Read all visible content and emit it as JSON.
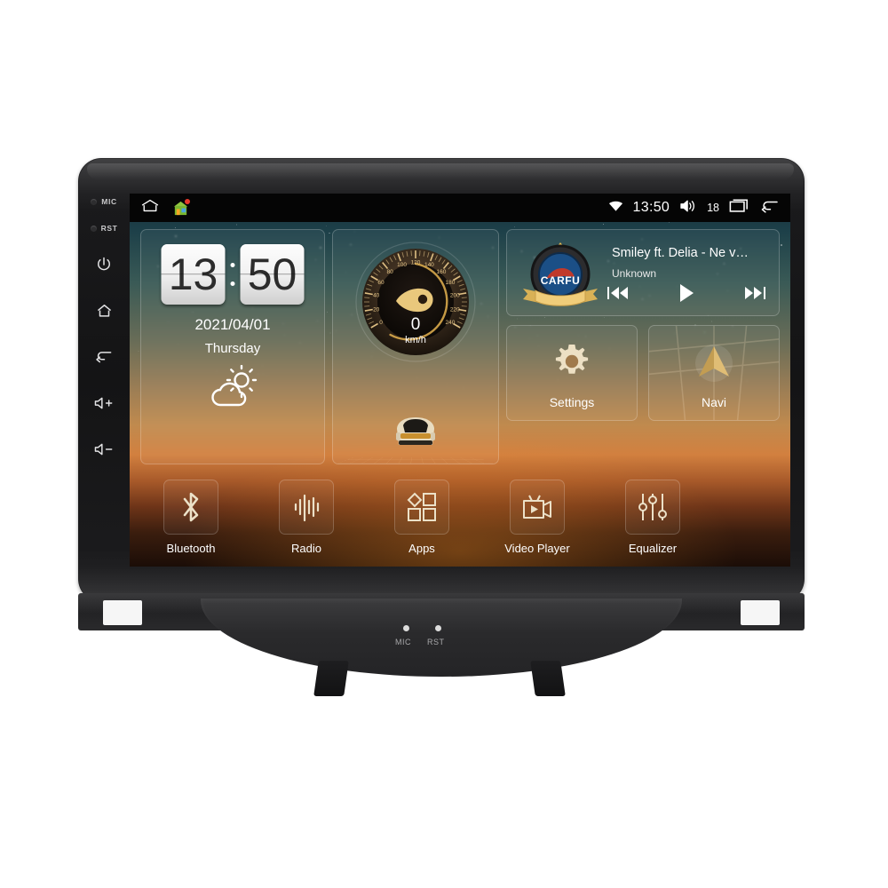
{
  "device": {
    "name": "car-stereo-head-unit",
    "side_buttons": [
      {
        "name": "mic-hole",
        "label": "MIC"
      },
      {
        "name": "reset-hole",
        "label": "RST"
      },
      {
        "name": "power-button",
        "label": ""
      },
      {
        "name": "home-button",
        "label": ""
      },
      {
        "name": "back-button",
        "label": ""
      },
      {
        "name": "volume-up-button",
        "label": ""
      },
      {
        "name": "volume-down-button",
        "label": ""
      }
    ],
    "bottom_panel": {
      "mic_label": "MIC",
      "reset_label": "RST"
    }
  },
  "statusbar": {
    "home_icon": "home-outline-icon",
    "app_icon": "house-app-icon",
    "wifi_icon": "wifi-icon",
    "time": "13:50",
    "volume_icon": "volume-icon",
    "volume_level": "18",
    "recents_icon": "recents-icon",
    "back_icon": "back-arrow-icon"
  },
  "clock_widget": {
    "hours": "13",
    "minutes": "50",
    "date": "2021/04/01",
    "weekday": "Thursday",
    "weather_icon": "partly-cloudy-icon"
  },
  "speedometer_widget": {
    "value": "0",
    "unit": "km/h",
    "ticks": [
      "0",
      "20",
      "40",
      "60",
      "80",
      "100",
      "120",
      "140",
      "160",
      "180",
      "200",
      "220",
      "240"
    ],
    "min": 0,
    "max": 240
  },
  "music_widget": {
    "logo_text": "CARFU",
    "title": "Smiley ft. Delia - Ne v…",
    "artist": "Unknown",
    "prev_icon": "previous-track-icon",
    "play_icon": "play-icon",
    "next_icon": "next-track-icon"
  },
  "tiles": [
    {
      "name": "settings",
      "label": "Settings",
      "icon": "gear-icon"
    },
    {
      "name": "navi",
      "label": "Navi",
      "icon": "navigation-arrow-icon"
    }
  ],
  "dock": [
    {
      "name": "bluetooth",
      "label": "Bluetooth",
      "icon": "bluetooth-icon"
    },
    {
      "name": "radio",
      "label": "Radio",
      "icon": "radio-waveform-icon"
    },
    {
      "name": "apps",
      "label": "Apps",
      "icon": "apps-grid-icon"
    },
    {
      "name": "video-player",
      "label": "Video Player",
      "icon": "video-camera-icon"
    },
    {
      "name": "equalizer",
      "label": "Equalizer",
      "icon": "equalizer-sliders-icon"
    }
  ],
  "colors": {
    "accent_gold": "#d8b46a",
    "bezel": "#141415",
    "statusbar": "#050505",
    "text": "#ffffff",
    "notification": "#e8392b",
    "logo_blue": "#1b4f86",
    "logo_red": "#c0392b"
  }
}
